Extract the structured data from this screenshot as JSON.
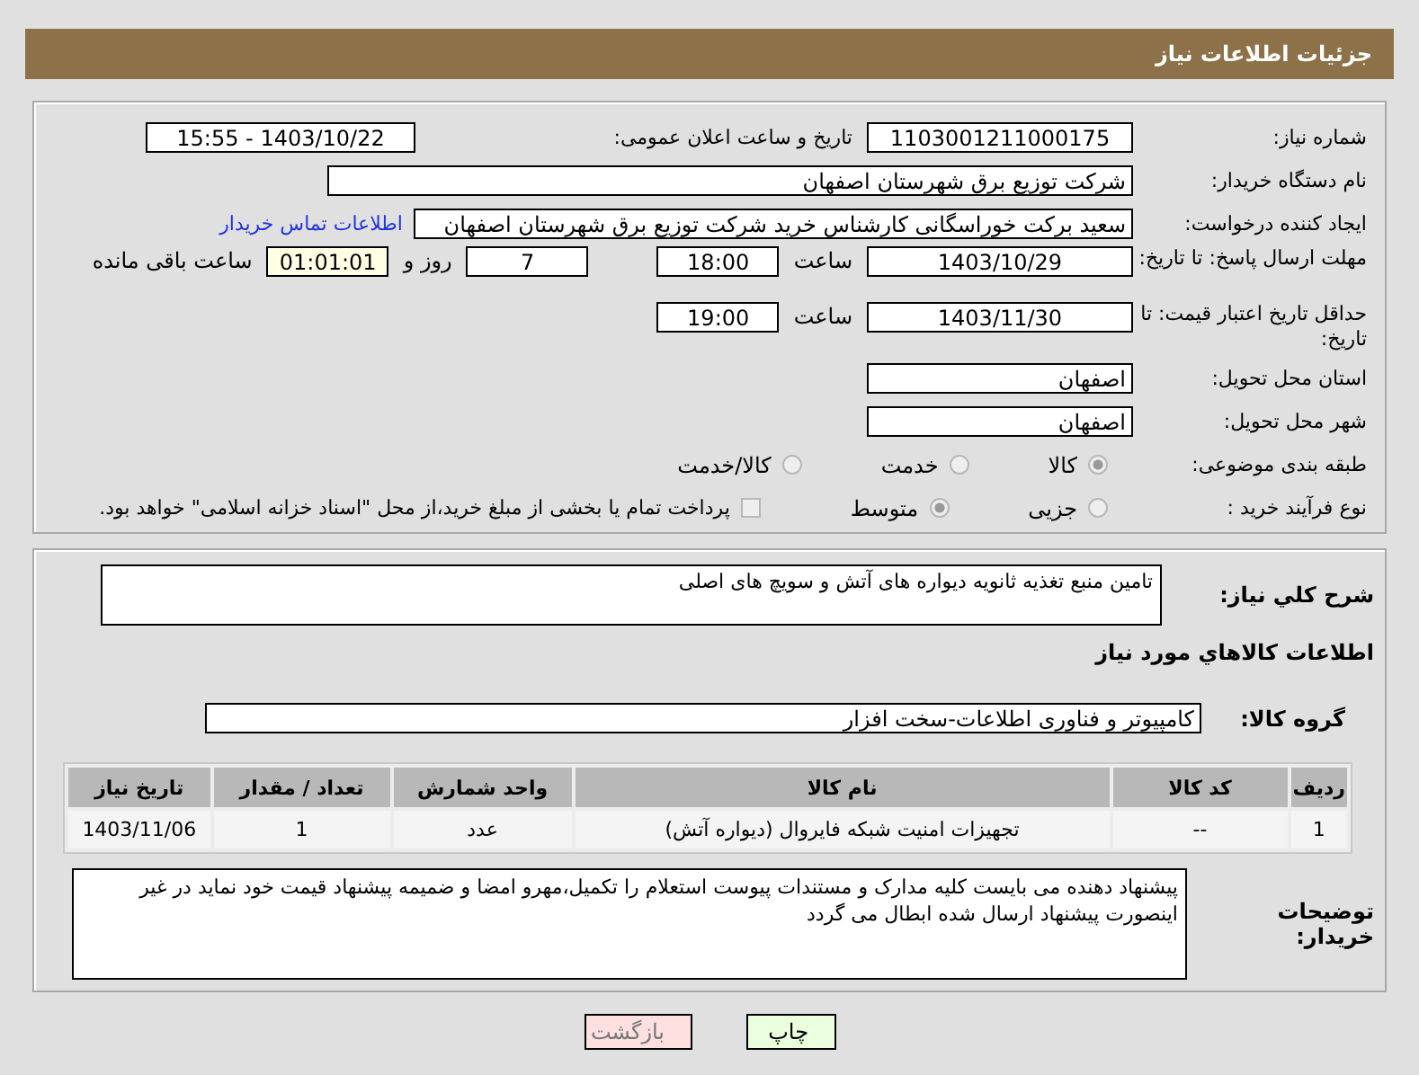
{
  "header": {
    "title": "جزئیات اطلاعات نیاز"
  },
  "need_number": {
    "label": "شماره نیاز:",
    "value": "1103001211000175"
  },
  "announce": {
    "label": "تاریخ و ساعت اعلان عمومی:",
    "value": "1403/10/22 - 15:55"
  },
  "buyer": {
    "label": "نام دستگاه خریدار:",
    "value": "شرکت توزیع برق شهرستان اصفهان"
  },
  "requester": {
    "label": "ایجاد کننده درخواست:",
    "value": "سعید برکت خوراسگانی کارشناس خرید شرکت توزیع برق شهرستان اصفهان",
    "link": "اطلاعات تماس خریدار"
  },
  "reply_deadline": {
    "label": "مهلت ارسال پاسخ: تا تاریخ:",
    "date": "1403/10/29",
    "time_label": "ساعت",
    "time": "18:00",
    "days": "7",
    "days_label": "روز و",
    "remaining": "01:01:01",
    "remaining_label": "ساعت باقی مانده"
  },
  "price_validity": {
    "label": "حداقل تاریخ اعتبار قیمت: تا تاریخ:",
    "date": "1403/11/30",
    "time_label": "ساعت",
    "time": "19:00"
  },
  "province": {
    "label": "استان محل تحویل:",
    "value": "اصفهان"
  },
  "city": {
    "label": "شهر محل تحویل:",
    "value": "اصفهان"
  },
  "category": {
    "label": "طبقه بندی موضوعی:",
    "options": [
      {
        "label": "کالا",
        "selected": true
      },
      {
        "label": "خدمت",
        "selected": false
      },
      {
        "label": "کالا/خدمت",
        "selected": false
      }
    ]
  },
  "process": {
    "label": "نوع فرآیند خرید :",
    "options": [
      {
        "label": "جزیی",
        "selected": false
      },
      {
        "label": "متوسط",
        "selected": true
      }
    ],
    "payment": {
      "checked": false,
      "text": "پرداخت تمام یا بخشی از مبلغ خرید،از محل \"اسناد خزانه اسلامی\" خواهد بود."
    }
  },
  "description": {
    "label": "شرح کلي نياز:",
    "value": "تامین منبع تغذیه ثانویه دیواره های آتش و سویچ های اصلی"
  },
  "goods_title": "اطلاعات کالاهاي مورد نياز",
  "goods_group": {
    "label": "گروه کالا:",
    "value": "کامپیوتر و فناوری اطلاعات-سخت افزار"
  },
  "table": {
    "columns": [
      "رديف",
      "کد کالا",
      "نام کالا",
      "واحد شمارش",
      "تعداد / مقدار",
      "تاریخ نیاز"
    ],
    "rows": [
      [
        "1",
        "--",
        "تجهیزات امنیت شبکه فایروال (دیواره آتش)",
        "عدد",
        "1",
        "1403/11/06"
      ]
    ]
  },
  "buyer_notes": {
    "label": "توضیحات خریدار:",
    "value": "پیشنهاد دهنده می بایست کلیه مدارک و مستندات پیوست استعلام را تکمیل،مهرو امضا و ضمیمه پیشنهاد قیمت خود نماید در غیر اینصورت پیشنهاد ارسال شده ابطال می گردد"
  },
  "buttons": [
    {
      "label": "چاپ",
      "kind": "print"
    },
    {
      "label": "بازگشت",
      "kind": "back"
    }
  ]
}
